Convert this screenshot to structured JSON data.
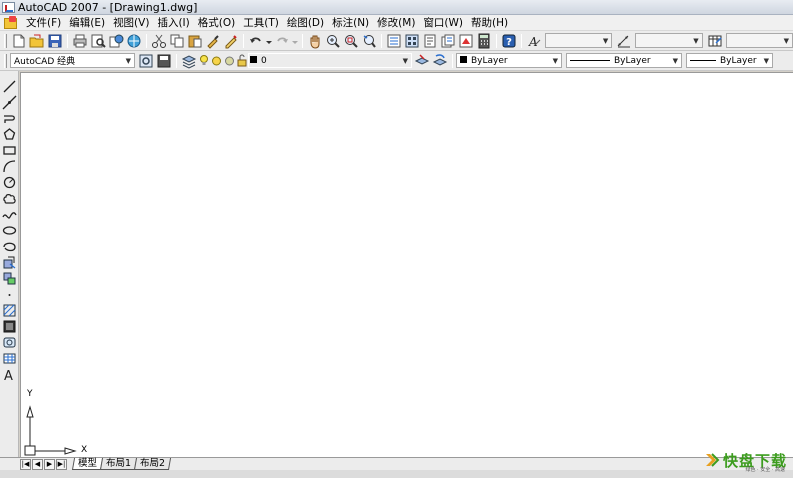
{
  "window": {
    "title": "AutoCAD 2007 - [Drawing1.dwg]"
  },
  "menubar": {
    "items": [
      "文件(F)",
      "编辑(E)",
      "视图(V)",
      "插入(I)",
      "格式(O)",
      "工具(T)",
      "绘图(D)",
      "标注(N)",
      "修改(M)",
      "窗口(W)",
      "帮助(H)"
    ]
  },
  "toolbar2": {
    "workspace": "AutoCAD 经典",
    "layer": "0",
    "color": "ByLayer",
    "linetype": "ByLayer",
    "lineweight": "ByLayer"
  },
  "left_tools": [
    "line-icon",
    "construction-line-icon",
    "polyline-icon",
    "polygon-icon",
    "rectangle-icon",
    "arc-icon",
    "circle-icon",
    "revision-cloud-icon",
    "spline-icon",
    "ellipse-icon",
    "ellipse-arc-icon",
    "insert-block-icon",
    "make-block-icon",
    "point-icon",
    "hatch-icon",
    "gradient-icon",
    "region-icon",
    "table-icon",
    "multiline-text-icon"
  ],
  "ucs": {
    "x_label": "X",
    "y_label": "Y"
  },
  "layout_tabs": {
    "model": "模型",
    "layout1": "布局1",
    "layout2": "布局2"
  },
  "watermark": {
    "name": "快盘下载",
    "sub": "绿色 · 安全 · 高速"
  },
  "colors": {
    "canvas": "#ffffff",
    "chrome": "#ececec",
    "accent": "#3c9c1e"
  }
}
